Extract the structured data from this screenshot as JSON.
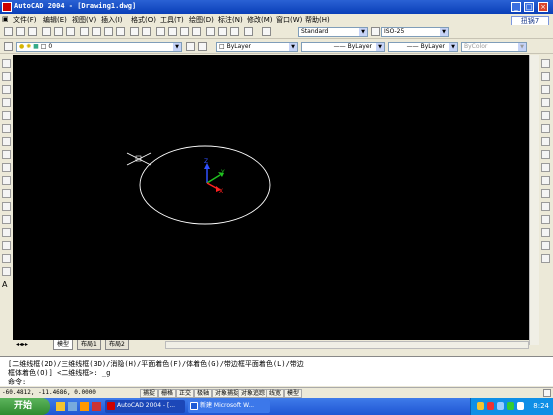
{
  "window": {
    "title": "AutoCAD 2004 - [Drawing1.dwg]",
    "badge": "扭锅7"
  },
  "menu": [
    "文件(F)",
    "编辑(E)",
    "视图(V)",
    "插入(I)",
    "格式(O)",
    "工具(T)",
    "绘图(D)",
    "标注(N)",
    "修改(M)",
    "窗口(W)",
    "帮助(H)"
  ],
  "toolbar": {
    "text_style": "Standard",
    "dim_style": "ISO-25",
    "layer_value": "0",
    "color": "ByLayer",
    "linetype": "ByLayer",
    "lineweight": "ByLayer",
    "plotstyle": "ByColor"
  },
  "tabs": [
    "模型",
    "布局1",
    "布局2"
  ],
  "command": {
    "line1": "[二维线框(2D)/三维线框(3D)/消隐(H)/平面着色(F)/体着色(G)/带边框平面着色(L)/带边",
    "line2": "框体着色(O)] <二维线框>: _g",
    "prompt": "命令:"
  },
  "status": {
    "coords": "-60.4812, -11.4686, 0.0000",
    "buttons": [
      "捕捉",
      "栅格",
      "正交",
      "极轴",
      "对象捕捉",
      "对象追踪",
      "线宽",
      "模型"
    ]
  },
  "taskbar": {
    "start": "开始",
    "tasks": [
      "AutoCAD 2004 - [...",
      "新建 Microsoft W..."
    ],
    "clock": "8:24"
  },
  "colors": {
    "canvas": "#000000",
    "circle": "#ffffff",
    "ucs_x": "#ff2020",
    "ucs_y": "#20c020",
    "ucs_z": "#3050ff"
  }
}
